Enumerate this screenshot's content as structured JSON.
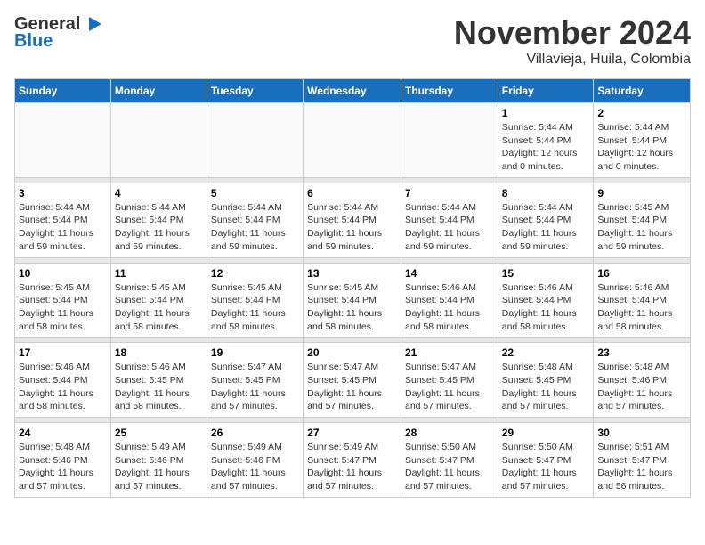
{
  "logo": {
    "general": "General",
    "blue": "Blue"
  },
  "title": "November 2024",
  "subtitle": "Villavieja, Huila, Colombia",
  "days_header": [
    "Sunday",
    "Monday",
    "Tuesday",
    "Wednesday",
    "Thursday",
    "Friday",
    "Saturday"
  ],
  "weeks": [
    [
      {
        "day": "",
        "info": ""
      },
      {
        "day": "",
        "info": ""
      },
      {
        "day": "",
        "info": ""
      },
      {
        "day": "",
        "info": ""
      },
      {
        "day": "",
        "info": ""
      },
      {
        "day": "1",
        "info": "Sunrise: 5:44 AM\nSunset: 5:44 PM\nDaylight: 12 hours and 0 minutes."
      },
      {
        "day": "2",
        "info": "Sunrise: 5:44 AM\nSunset: 5:44 PM\nDaylight: 12 hours and 0 minutes."
      }
    ],
    [
      {
        "day": "3",
        "info": "Sunrise: 5:44 AM\nSunset: 5:44 PM\nDaylight: 11 hours and 59 minutes."
      },
      {
        "day": "4",
        "info": "Sunrise: 5:44 AM\nSunset: 5:44 PM\nDaylight: 11 hours and 59 minutes."
      },
      {
        "day": "5",
        "info": "Sunrise: 5:44 AM\nSunset: 5:44 PM\nDaylight: 11 hours and 59 minutes."
      },
      {
        "day": "6",
        "info": "Sunrise: 5:44 AM\nSunset: 5:44 PM\nDaylight: 11 hours and 59 minutes."
      },
      {
        "day": "7",
        "info": "Sunrise: 5:44 AM\nSunset: 5:44 PM\nDaylight: 11 hours and 59 minutes."
      },
      {
        "day": "8",
        "info": "Sunrise: 5:44 AM\nSunset: 5:44 PM\nDaylight: 11 hours and 59 minutes."
      },
      {
        "day": "9",
        "info": "Sunrise: 5:45 AM\nSunset: 5:44 PM\nDaylight: 11 hours and 59 minutes."
      }
    ],
    [
      {
        "day": "10",
        "info": "Sunrise: 5:45 AM\nSunset: 5:44 PM\nDaylight: 11 hours and 58 minutes."
      },
      {
        "day": "11",
        "info": "Sunrise: 5:45 AM\nSunset: 5:44 PM\nDaylight: 11 hours and 58 minutes."
      },
      {
        "day": "12",
        "info": "Sunrise: 5:45 AM\nSunset: 5:44 PM\nDaylight: 11 hours and 58 minutes."
      },
      {
        "day": "13",
        "info": "Sunrise: 5:45 AM\nSunset: 5:44 PM\nDaylight: 11 hours and 58 minutes."
      },
      {
        "day": "14",
        "info": "Sunrise: 5:46 AM\nSunset: 5:44 PM\nDaylight: 11 hours and 58 minutes."
      },
      {
        "day": "15",
        "info": "Sunrise: 5:46 AM\nSunset: 5:44 PM\nDaylight: 11 hours and 58 minutes."
      },
      {
        "day": "16",
        "info": "Sunrise: 5:46 AM\nSunset: 5:44 PM\nDaylight: 11 hours and 58 minutes."
      }
    ],
    [
      {
        "day": "17",
        "info": "Sunrise: 5:46 AM\nSunset: 5:44 PM\nDaylight: 11 hours and 58 minutes."
      },
      {
        "day": "18",
        "info": "Sunrise: 5:46 AM\nSunset: 5:45 PM\nDaylight: 11 hours and 58 minutes."
      },
      {
        "day": "19",
        "info": "Sunrise: 5:47 AM\nSunset: 5:45 PM\nDaylight: 11 hours and 57 minutes."
      },
      {
        "day": "20",
        "info": "Sunrise: 5:47 AM\nSunset: 5:45 PM\nDaylight: 11 hours and 57 minutes."
      },
      {
        "day": "21",
        "info": "Sunrise: 5:47 AM\nSunset: 5:45 PM\nDaylight: 11 hours and 57 minutes."
      },
      {
        "day": "22",
        "info": "Sunrise: 5:48 AM\nSunset: 5:45 PM\nDaylight: 11 hours and 57 minutes."
      },
      {
        "day": "23",
        "info": "Sunrise: 5:48 AM\nSunset: 5:46 PM\nDaylight: 11 hours and 57 minutes."
      }
    ],
    [
      {
        "day": "24",
        "info": "Sunrise: 5:48 AM\nSunset: 5:46 PM\nDaylight: 11 hours and 57 minutes."
      },
      {
        "day": "25",
        "info": "Sunrise: 5:49 AM\nSunset: 5:46 PM\nDaylight: 11 hours and 57 minutes."
      },
      {
        "day": "26",
        "info": "Sunrise: 5:49 AM\nSunset: 5:46 PM\nDaylight: 11 hours and 57 minutes."
      },
      {
        "day": "27",
        "info": "Sunrise: 5:49 AM\nSunset: 5:47 PM\nDaylight: 11 hours and 57 minutes."
      },
      {
        "day": "28",
        "info": "Sunrise: 5:50 AM\nSunset: 5:47 PM\nDaylight: 11 hours and 57 minutes."
      },
      {
        "day": "29",
        "info": "Sunrise: 5:50 AM\nSunset: 5:47 PM\nDaylight: 11 hours and 57 minutes."
      },
      {
        "day": "30",
        "info": "Sunrise: 5:51 AM\nSunset: 5:47 PM\nDaylight: 11 hours and 56 minutes."
      }
    ]
  ]
}
